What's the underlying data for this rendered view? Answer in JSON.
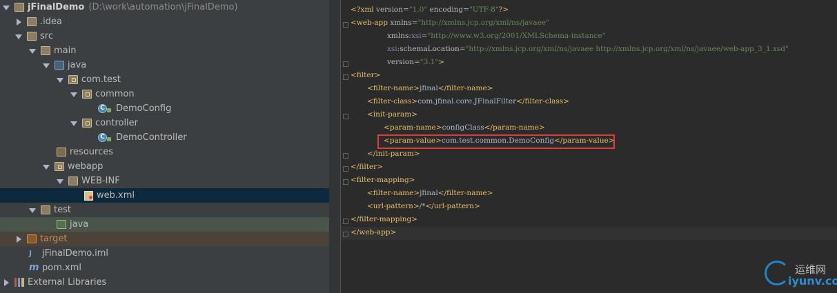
{
  "project_tree": {
    "items": [
      {
        "label": "jFinalDemo",
        "path": "D:\\work\\automation\\jFinalDemo"
      },
      {
        "label": ".idea"
      },
      {
        "label": "src"
      },
      {
        "label": "main"
      },
      {
        "label": "java"
      },
      {
        "label": "com.test"
      },
      {
        "label": "common"
      },
      {
        "label": "DemoConfig"
      },
      {
        "label": "controller"
      },
      {
        "label": "DemoController"
      },
      {
        "label": "resources"
      },
      {
        "label": "webapp"
      },
      {
        "label": "WEB-INF"
      },
      {
        "label": "web.xml"
      },
      {
        "label": "test"
      },
      {
        "label": "java"
      },
      {
        "label": "target"
      },
      {
        "label": "jFinalDemo.iml"
      },
      {
        "label": "pom.xml"
      },
      {
        "label": "External Libraries"
      }
    ],
    "icons": {
      "class_icon_letter": "C",
      "iml_icon_text": "J",
      "pom_icon_text": "m"
    }
  },
  "editor": {
    "code": {
      "xml_decl": {
        "start": "<?xml ",
        "version_attr": "version",
        "eq1": "=",
        "version_val": "\"1.0\"",
        "encoding_attr": " encoding",
        "eq2": "=",
        "encoding_val": "\"UTF-8\"",
        "end": "?>"
      },
      "webapp_open": {
        "tag": "<web-app ",
        "attr": "xmlns",
        "eq": "=",
        "val": "\"http://xmlns.jcp.org/xml/ns/javaee\""
      },
      "xsi_ns": {
        "attr1": "xmlns",
        "colon": ":",
        "attr2": "xsi",
        "eq": "=",
        "val": "\"http://www.w3.org/2001/XMLSchema-instance\""
      },
      "schema_loc": {
        "ns": "xsi",
        "colon": ":",
        "attr": "schemaLocation",
        "eq": "=",
        "val": "\"http://xmlns.jcp.org/xml/ns/javaee http://xmlns.jcp.org/xml/ns/javaee/web-app_3_1.xsd\""
      },
      "version_line": {
        "attr": "version",
        "eq": "=",
        "val": "\"3.1\"",
        "end": ">"
      },
      "filter_open": "<filter>",
      "filter_name": {
        "open": "<filter-name>",
        "text": "jfinal",
        "close": "</filter-name>"
      },
      "filter_class": {
        "open": "<filter-class>",
        "text": "com.jfinal.core.JFinalFilter",
        "close": "</filter-class>"
      },
      "init_param_open": "<init-param>",
      "param_name": {
        "open": "<param-name>",
        "text": "configClass",
        "close": "</param-name>"
      },
      "param_value": {
        "open": "<param-value>",
        "text": "com.test.common.DemoConfig",
        "close": "</param-value>"
      },
      "init_param_close": "</init-param>",
      "filter_close": "</filter>",
      "filter_mapping_open": "<filter-mapping>",
      "fm_filter_name": {
        "open": "<filter-name>",
        "text": "jfinal",
        "close": "</filter-name>"
      },
      "url_pattern": {
        "open": "<url-pattern>",
        "text": "/*",
        "close": "</url-pattern>"
      },
      "filter_mapping_close": "</filter-mapping>",
      "webapp_close": "</web-app>"
    }
  },
  "watermark": {
    "cn_text": "运维网",
    "en_text": "iyunv.com"
  },
  "colors": {
    "tree_bg": "#3c3f41",
    "editor_bg": "#2b2b2b",
    "tag": "#e8bf6a",
    "string": "#6a8759",
    "highlight_box": "#e53935",
    "selection": "#0d293e"
  }
}
